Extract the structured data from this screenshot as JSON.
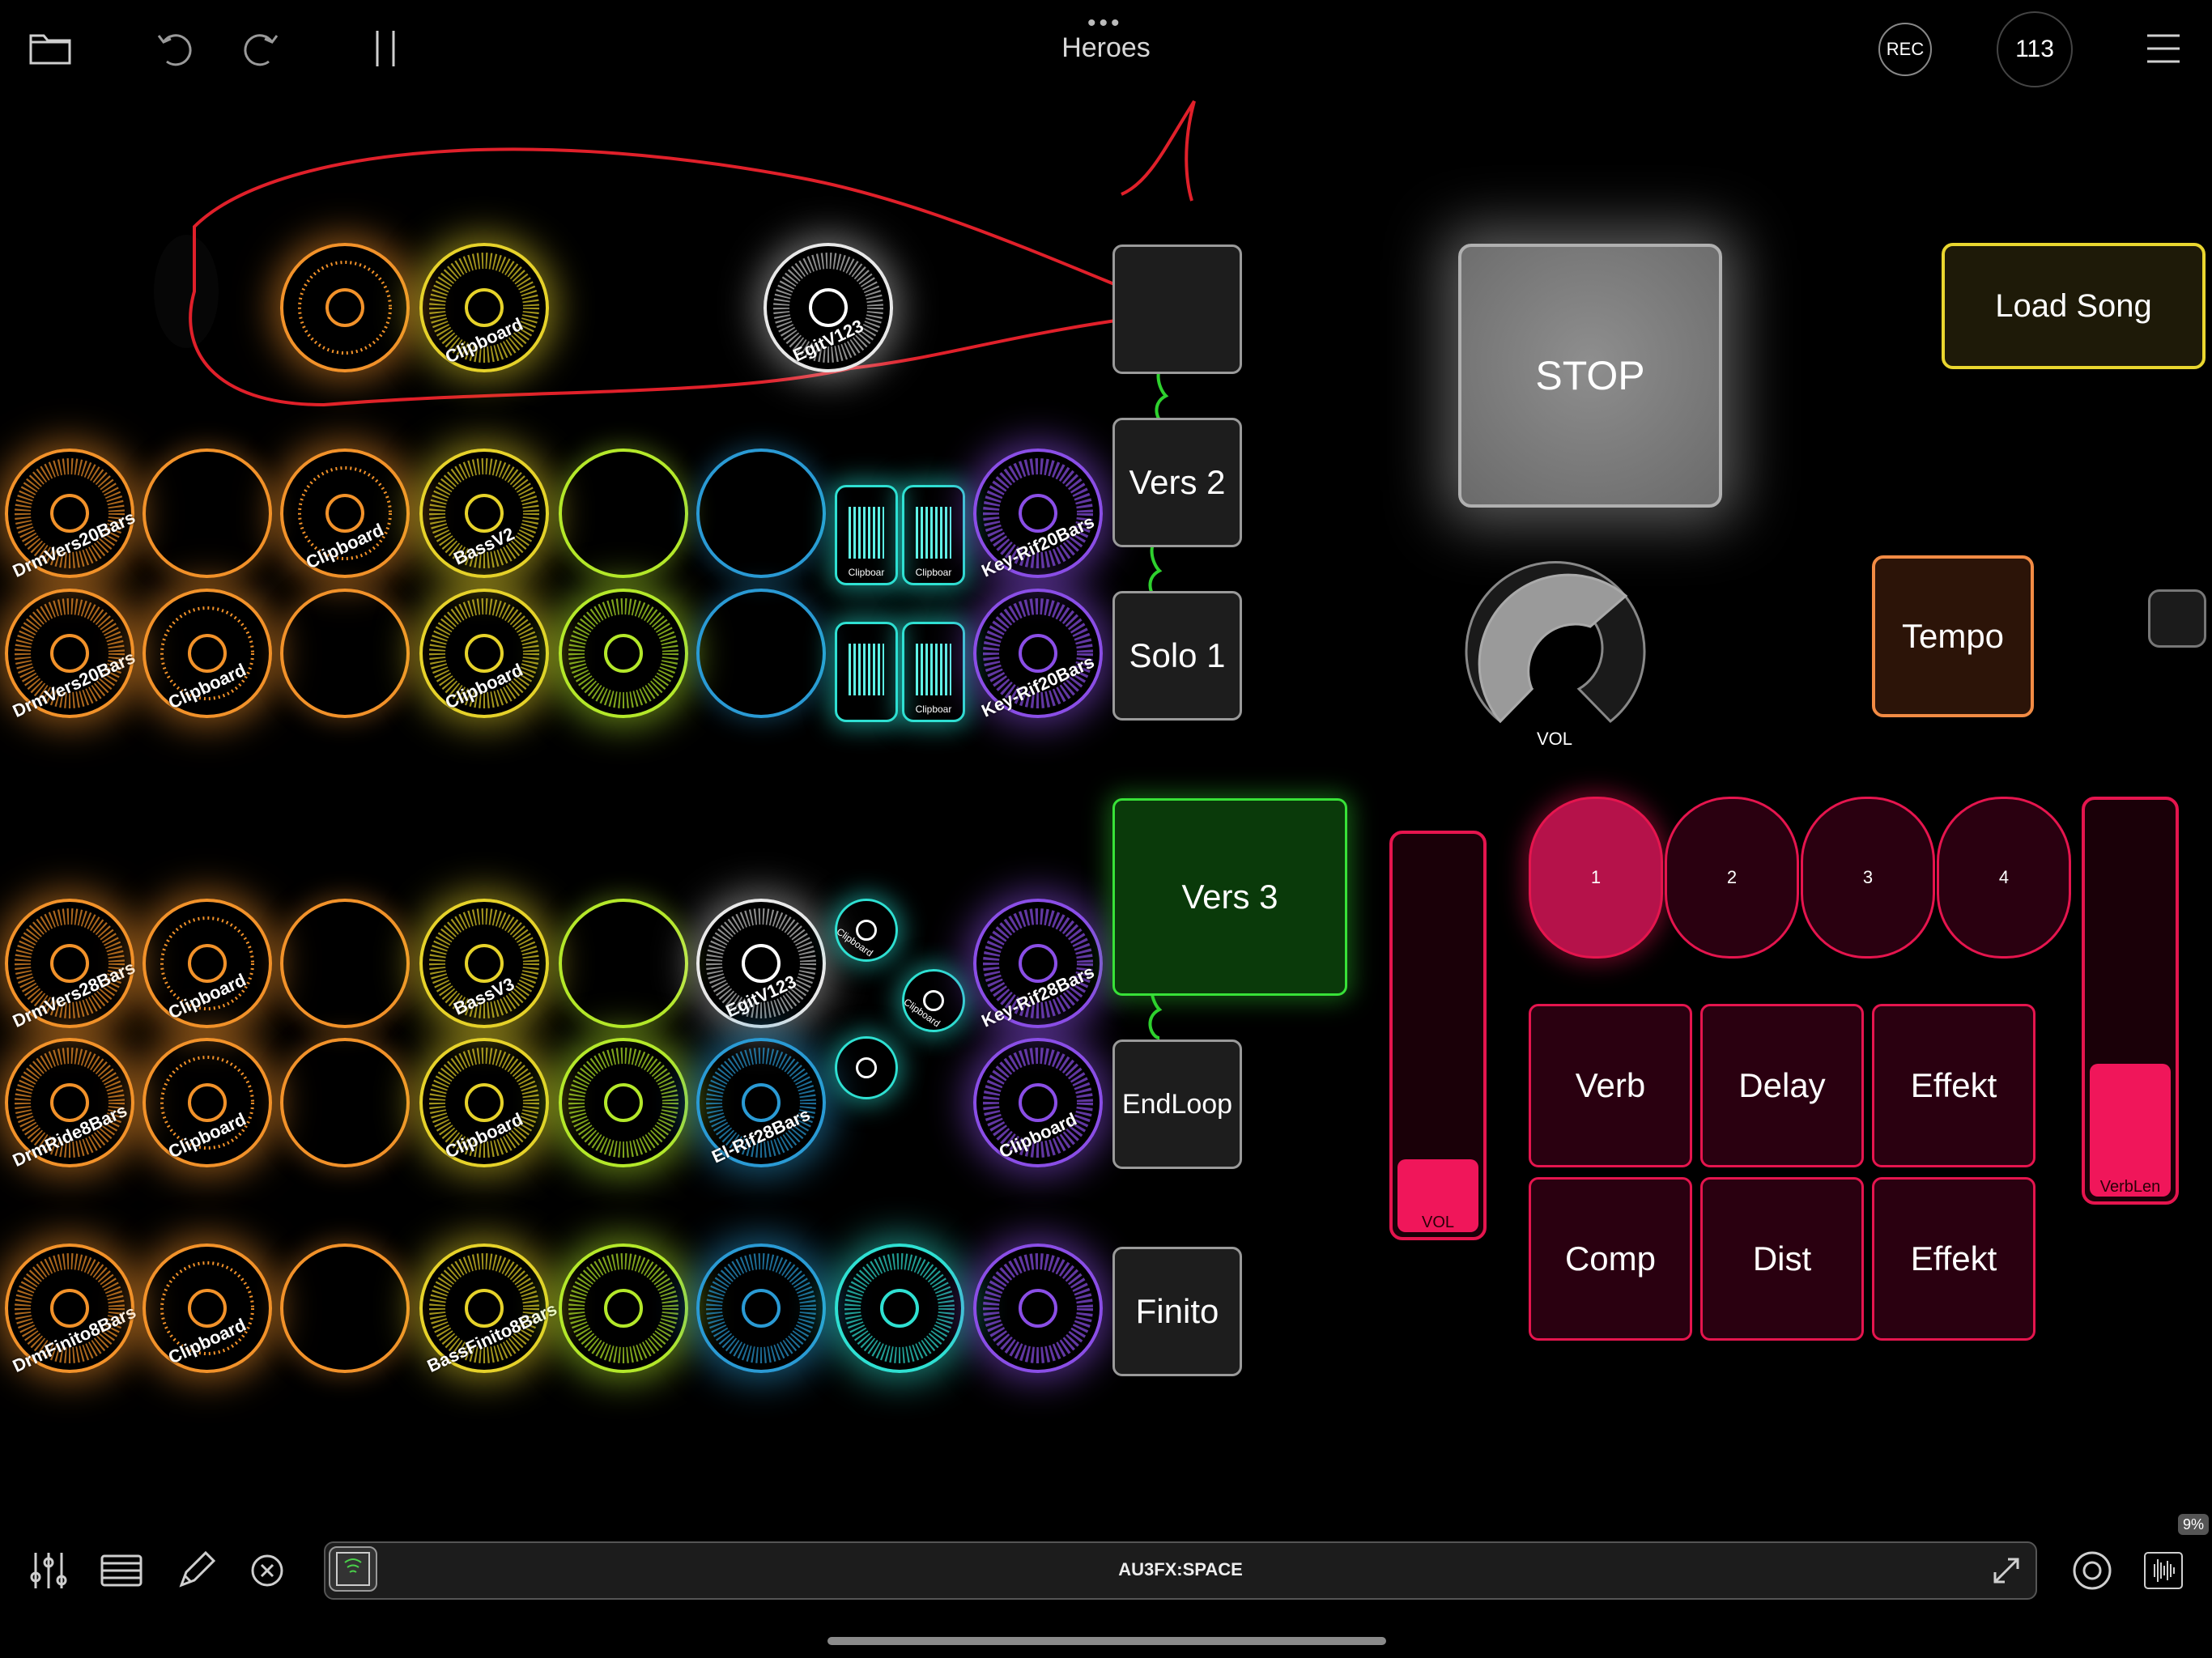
{
  "title": "Heroes",
  "topbar": {
    "rec_label": "REC",
    "tempo_value": "113"
  },
  "scenes": {
    "s1": "",
    "vers2": "Vers 2",
    "solo1": "Solo 1",
    "vers3": "Vers 3",
    "endloop": "EndLoop",
    "finito": "Finito"
  },
  "controls": {
    "stop": "STOP",
    "load_song": "Load Song",
    "tempo": "Tempo",
    "vol_label": "VOL",
    "vol_level": 0.5
  },
  "faders": [
    {
      "label": "VOL",
      "level": 0.18
    },
    {
      "label": "VerbLen",
      "level": 0.33
    }
  ],
  "pads": [
    {
      "label": "1",
      "active": true
    },
    {
      "label": "2",
      "active": false
    },
    {
      "label": "3",
      "active": false
    },
    {
      "label": "4",
      "active": false
    }
  ],
  "fx": [
    "Verb",
    "Delay",
    "Effekt",
    "Comp",
    "Dist",
    "Effekt"
  ],
  "bottombar": {
    "au_label": "AU3FX:SPACE",
    "cpu": "9%"
  },
  "clip_labels": {
    "r1_c2": "Clipboard",
    "r1_c5": "EgitV123",
    "r2_c1": "DrmVers20Bars",
    "r2_c3": "Clipboard",
    "r2_c4": "BassV2",
    "r2_c8": "Key-Rif20Bars",
    "r3_c1": "DrmVers20Bars",
    "r3_c2": "Clipboard",
    "r3_c4": "Clipboard",
    "r3_c8": "Key-Rif20Bars",
    "r4_c1": "DrmVers28Bars",
    "r4_c2": "Clipboard",
    "r4_c4": "BassV3",
    "r4_c6": "EgitV123",
    "r4_c8": "Key-Rif28Bars",
    "r5_c1": "DrmRide8Bars",
    "r5_c2": "Clipboard",
    "r5_c4": "Clipboard",
    "r5_c6": "El-Rif28Bars",
    "r5_c8": "Clipboard",
    "r6_c1": "DrmFinito8Bars",
    "r6_c2": "Clipboard",
    "r6_c4": "BassFinito8Bars",
    "mini1": "Clipboar",
    "mini2": "Clipboar",
    "mini3": "Clipboar",
    "mini4": "Clipboar",
    "small1": "Clipboard",
    "small2": "Clipboard"
  },
  "colors": {
    "orange": "#f2922a",
    "yellow": "#e6d22a",
    "lime": "#b4e82a",
    "blue": "#2a9ad4",
    "teal": "#2fe0d2",
    "purple": "#8a4ee6",
    "white": "#e8e8e8",
    "pink": "#e5154e",
    "green": "#38e238"
  }
}
